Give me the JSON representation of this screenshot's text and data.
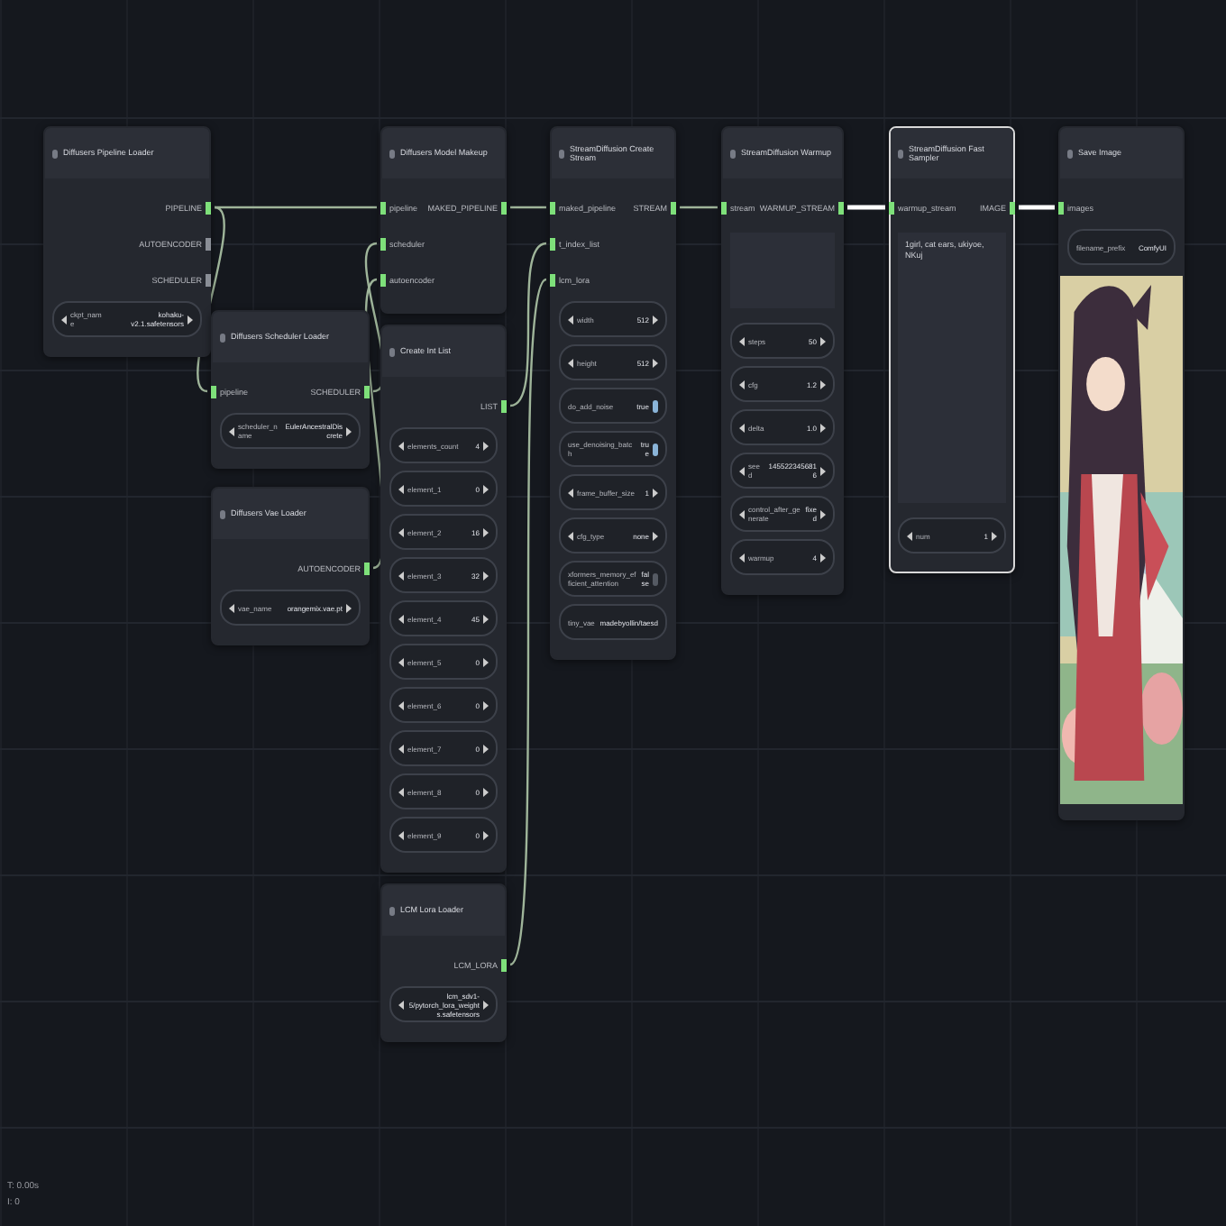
{
  "nodes": [
    {
      "title": "Diffusers Pipeline Loader",
      "selected": false,
      "outputs": [
        {
          "label": "PIPELINE"
        },
        {
          "label": "AUTOENCODER"
        },
        {
          "label": "SCHEDULER"
        }
      ],
      "widgets": [
        {
          "kind": "combo",
          "name": "ckpt_name",
          "value": "kohaku-v2.1.safetensors"
        }
      ]
    },
    {
      "title": "Diffusers Scheduler Loader",
      "selected": false,
      "inputs": [
        {
          "label": "pipeline"
        }
      ],
      "outputs": [
        {
          "label": "SCHEDULER"
        }
      ],
      "widgets": [
        {
          "kind": "combo",
          "name": "scheduler_name",
          "value": "EulerAncestralDiscrete"
        }
      ]
    },
    {
      "title": "Diffusers Vae Loader",
      "selected": false,
      "outputs": [
        {
          "label": "AUTOENCODER"
        }
      ],
      "widgets": [
        {
          "kind": "combo",
          "name": "vae_name",
          "value": "orangemix.vae.pt"
        }
      ]
    },
    {
      "title": "Diffusers Model Makeup",
      "selected": false,
      "inputs": [
        {
          "label": "pipeline"
        },
        {
          "label": "scheduler"
        },
        {
          "label": "autoencoder"
        }
      ],
      "outputs": [
        {
          "label": "MAKED_PIPELINE"
        }
      ]
    },
    {
      "title": "Create Int List",
      "selected": false,
      "outputs": [
        {
          "label": "LIST"
        }
      ],
      "widgets": [
        {
          "kind": "number",
          "name": "elements_count",
          "value": "4"
        },
        {
          "kind": "number",
          "name": "element_1",
          "value": "0"
        },
        {
          "kind": "number",
          "name": "element_2",
          "value": "16"
        },
        {
          "kind": "number",
          "name": "element_3",
          "value": "32"
        },
        {
          "kind": "number",
          "name": "element_4",
          "value": "45"
        },
        {
          "kind": "number",
          "name": "element_5",
          "value": "0"
        },
        {
          "kind": "number",
          "name": "element_6",
          "value": "0"
        },
        {
          "kind": "number",
          "name": "element_7",
          "value": "0"
        },
        {
          "kind": "number",
          "name": "element_8",
          "value": "0"
        },
        {
          "kind": "number",
          "name": "element_9",
          "value": "0"
        }
      ]
    },
    {
      "title": "LCM Lora Loader",
      "selected": false,
      "outputs": [
        {
          "label": "LCM_LORA"
        }
      ],
      "widgets": [
        {
          "kind": "combo",
          "value": "lcm_sdv1-5/pytorch_lora_weights.safetensors"
        }
      ]
    },
    {
      "title": "StreamDiffusion Create Stream",
      "selected": false,
      "inputs": [
        {
          "label": "maked_pipeline"
        },
        {
          "label": "t_index_list"
        },
        {
          "label": "lcm_lora"
        }
      ],
      "outputs": [
        {
          "label": "STREAM"
        }
      ],
      "widgets": [
        {
          "kind": "number",
          "name": "width",
          "value": "512"
        },
        {
          "kind": "number",
          "name": "height",
          "value": "512"
        },
        {
          "kind": "toggle",
          "name": "do_add_noise",
          "value": "true",
          "on": true
        },
        {
          "kind": "toggle",
          "name": "use_denoising_batch",
          "value": "true",
          "on": true
        },
        {
          "kind": "number",
          "name": "frame_buffer_size",
          "value": "1"
        },
        {
          "kind": "combo",
          "name": "cfg_type",
          "value": "none"
        },
        {
          "kind": "toggle",
          "name": "xformers_memory_efficient_attention",
          "value": "false",
          "on": false
        },
        {
          "kind": "text",
          "name": "tiny_vae",
          "value": "madebyollin/taesd"
        }
      ]
    },
    {
      "title": "StreamDiffusion Warmup",
      "selected": false,
      "inputs": [
        {
          "label": "stream"
        }
      ],
      "outputs": [
        {
          "label": "WARMUP_STREAM"
        }
      ],
      "textarea": {
        "tall": false
      },
      "widgets": [
        {
          "kind": "number",
          "name": "steps",
          "value": "50"
        },
        {
          "kind": "number",
          "name": "cfg",
          "value": "1.2"
        },
        {
          "kind": "number",
          "name": "delta",
          "value": "1.0"
        },
        {
          "kind": "number",
          "name": "seed",
          "value": "1455223456816"
        },
        {
          "kind": "combo",
          "name": "control_after_generate",
          "value": "fixed"
        },
        {
          "kind": "number",
          "name": "warmup",
          "value": "4"
        }
      ]
    },
    {
      "title": "StreamDiffusion Fast Sampler",
      "selected": true,
      "inputs": [
        {
          "label": "warmup_stream"
        }
      ],
      "outputs": [
        {
          "label": "IMAGE"
        }
      ],
      "textarea": {
        "text": "1girl, cat ears, ukiyoe, NKuj",
        "tall": true
      },
      "widgets": [
        {
          "kind": "number",
          "name": "num",
          "value": "1"
        }
      ]
    },
    {
      "title": "Save Image",
      "selected": false,
      "inputs": [
        {
          "label": "images"
        }
      ],
      "widgets": [
        {
          "kind": "text",
          "name": "filename_prefix",
          "value": "ComfyUI"
        }
      ],
      "preview": {
        "kind": "picture"
      }
    }
  ],
  "stats": [
    "T: 0.00s",
    "I: 0"
  ]
}
